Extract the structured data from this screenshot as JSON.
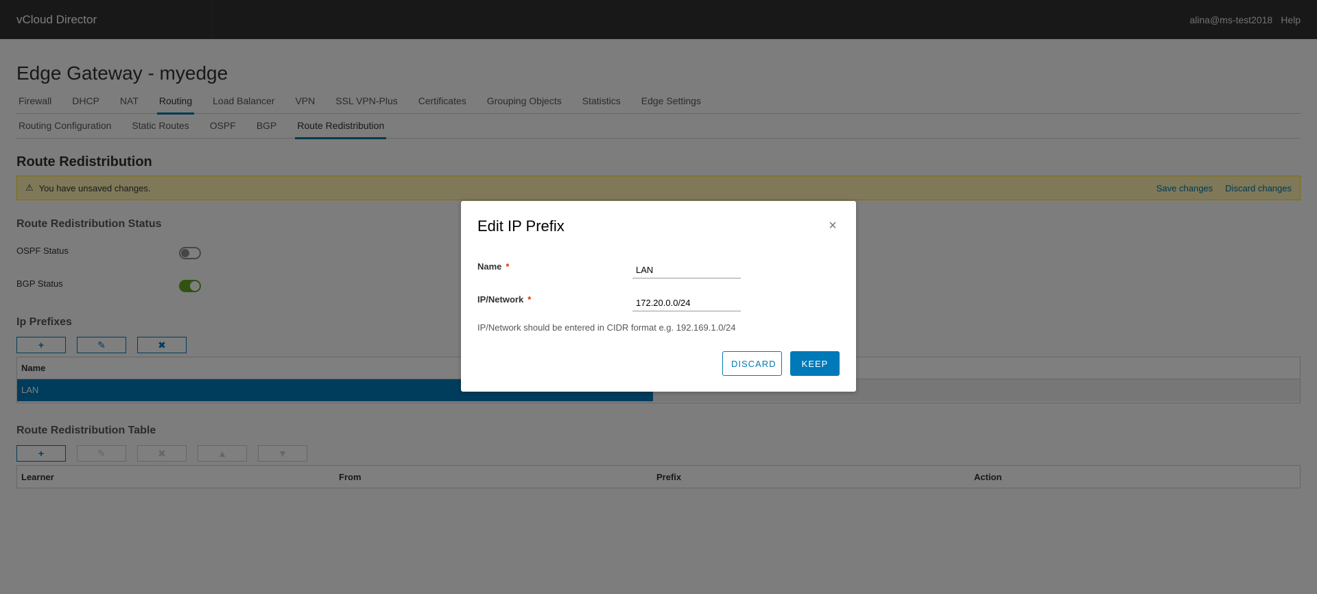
{
  "header": {
    "brand": "vCloud Director",
    "user": "alina@ms-test2018",
    "help": "Help"
  },
  "page": {
    "title": "Edge Gateway - myedge"
  },
  "primary_tabs": [
    {
      "label": "Firewall",
      "active": false
    },
    {
      "label": "DHCP",
      "active": false
    },
    {
      "label": "NAT",
      "active": false
    },
    {
      "label": "Routing",
      "active": true
    },
    {
      "label": "Load Balancer",
      "active": false
    },
    {
      "label": "VPN",
      "active": false
    },
    {
      "label": "SSL VPN-Plus",
      "active": false
    },
    {
      "label": "Certificates",
      "active": false
    },
    {
      "label": "Grouping Objects",
      "active": false
    },
    {
      "label": "Statistics",
      "active": false
    },
    {
      "label": "Edge Settings",
      "active": false
    }
  ],
  "secondary_tabs": [
    {
      "label": "Routing Configuration",
      "active": false
    },
    {
      "label": "Static Routes",
      "active": false
    },
    {
      "label": "OSPF",
      "active": false
    },
    {
      "label": "BGP",
      "active": false
    },
    {
      "label": "Route Redistribution",
      "active": true
    }
  ],
  "section_title": "Route Redistribution",
  "alert": {
    "message": "You have unsaved changes.",
    "save": "Save changes",
    "discard": "Discard changes"
  },
  "status": {
    "title": "Route Redistribution Status",
    "ospf_label": "OSPF Status",
    "ospf_enabled": false,
    "bgp_label": "BGP Status",
    "bgp_enabled": true
  },
  "ip_prefixes": {
    "title": "Ip Prefixes",
    "column_name": "Name",
    "rows": [
      {
        "name": "LAN"
      }
    ]
  },
  "redistribution_table": {
    "title": "Route Redistribution Table",
    "columns": [
      "Learner",
      "From",
      "Prefix",
      "Action"
    ]
  },
  "modal": {
    "title": "Edit IP Prefix",
    "name_label": "Name",
    "name_value": "LAN",
    "network_label": "IP/Network",
    "network_value": "172.20.0.0/24",
    "helper": "IP/Network should be entered in CIDR format e.g. 192.169.1.0/24",
    "discard": "DISCARD",
    "keep": "KEEP"
  },
  "icons": {
    "add": "+",
    "edit": "✎",
    "delete": "✖",
    "move_up": "▲",
    "move_down": "▼",
    "close": "×",
    "warning": "⚠"
  },
  "colors": {
    "accent": "#0079b8",
    "header_bg": "#313131",
    "toggle_on": "#62a420",
    "alert_bg": "#fef3b5"
  }
}
